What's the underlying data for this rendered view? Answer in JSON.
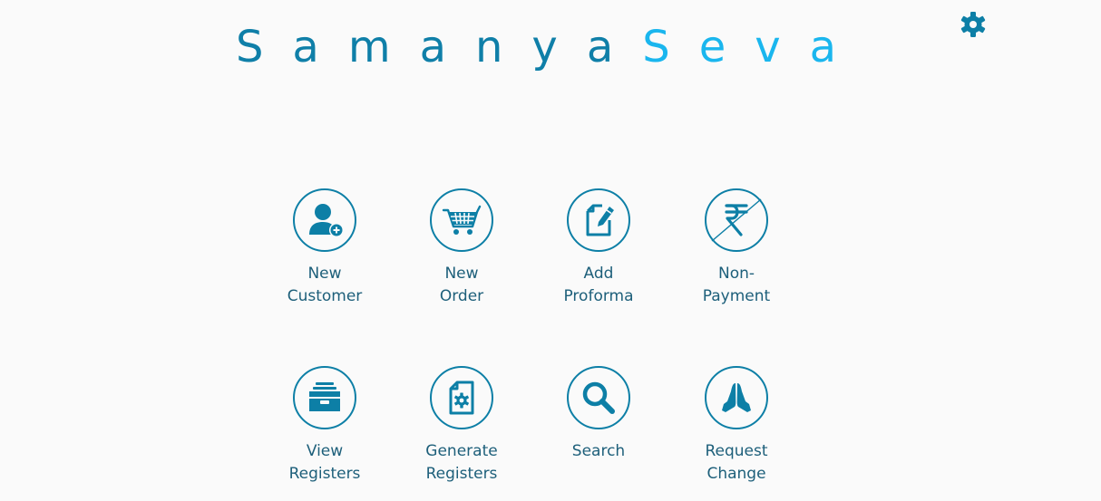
{
  "header": {
    "brand_part1": "Samanya",
    "brand_part2": "Seva"
  },
  "colors": {
    "primary": "#0d7fa6",
    "accent": "#1ab6ee",
    "label": "#1d5f7a",
    "background": "#fafafa"
  },
  "settings": {
    "icon": "gear-icon"
  },
  "tiles": [
    {
      "label": "New\nCustomer",
      "icon": "add-user-icon"
    },
    {
      "label": "New\nOrder",
      "icon": "shopping-cart-icon"
    },
    {
      "label": "Add\nProforma",
      "icon": "edit-document-icon"
    },
    {
      "label": "Non-\nPayment",
      "icon": "rupee-strikethrough-icon"
    },
    {
      "label": "View\nRegisters",
      "icon": "archive-drawer-icon"
    },
    {
      "label": "Generate\nRegisters",
      "icon": "document-gear-icon"
    },
    {
      "label": "Search",
      "icon": "search-icon"
    },
    {
      "label": "Request\nChange",
      "icon": "folded-hands-icon"
    }
  ]
}
